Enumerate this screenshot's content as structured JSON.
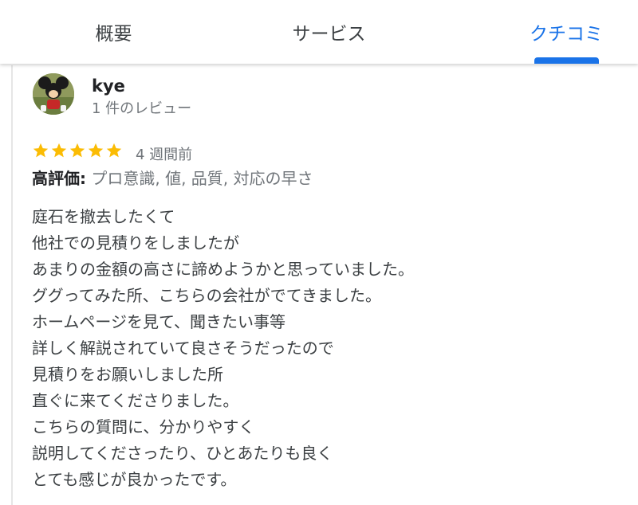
{
  "tabs": [
    {
      "label": "概要"
    },
    {
      "label": "サービス"
    },
    {
      "label": "クチコミ",
      "active": true
    }
  ],
  "accent_color": "#1a73e8",
  "star_color": "#fbbc04",
  "review": {
    "author": "kye",
    "author_sub": "1 件のレビュー",
    "avatar_icon": "mickey-mouse-avatar",
    "rating": 5,
    "time": "4 週間前",
    "highlights_label": "高評価:",
    "highlights_values": " プロ意識, 値, 品質, 対応の早さ",
    "lines": [
      "庭石を撤去したくて",
      "他社での見積りをしましたが",
      "あまりの金額の高さに諦めようかと思っていました。",
      "ググってみた所、こちらの会社がでてきました。",
      "ホームページを見て、聞きたい事等",
      "詳しく解説されていて良さそうだったので",
      "見積りをお願いしました所",
      "直ぐに来てくださりました。",
      "こちらの質問に、分かりやすく",
      "説明してくださったり、ひとあたりも良く",
      "とても感じが良かったです。"
    ]
  }
}
